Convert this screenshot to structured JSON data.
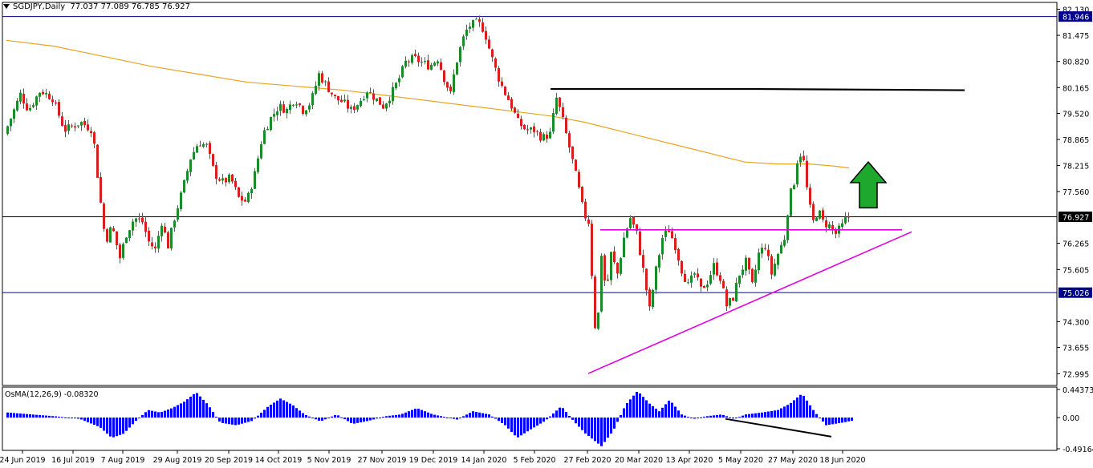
{
  "chart_data": {
    "type": "candlestick",
    "symbol": "SGDJPY,Daily",
    "ohlc_text": "77.037 77.089 76.785 76.927",
    "price_axis": {
      "ylim": [
        72.7,
        82.3
      ],
      "ticks": [
        "82.130",
        "81.475",
        "80.820",
        "80.165",
        "79.520",
        "78.865",
        "78.215",
        "77.560",
        "76.927",
        "76.265",
        "75.605",
        "75.026",
        "74.300",
        "73.655",
        "72.995"
      ],
      "labels_boxed": [
        "81.946",
        "76.927",
        "75.026"
      ]
    },
    "time_axis": {
      "ticks": [
        "24 Jun 2019",
        "16 Jul 2019",
        "7 Aug 2019",
        "29 Aug 2019",
        "20 Sep 2019",
        "14 Oct 2019",
        "5 Nov 2019",
        "27 Nov 2019",
        "19 Dec 2019",
        "14 Jan 2020",
        "5 Feb 2020",
        "27 Feb 2020",
        "20 Mar 2020",
        "13 Apr 2020",
        "5 May 2020",
        "27 May 2020",
        "18 Jun 2020"
      ]
    },
    "price_path": [
      [
        0,
        79.0
      ],
      [
        8,
        79.4
      ],
      [
        20,
        80.0
      ],
      [
        30,
        79.6
      ],
      [
        45,
        80.1
      ],
      [
        60,
        79.9
      ],
      [
        75,
        79.1
      ],
      [
        95,
        79.3
      ],
      [
        110,
        79.1
      ],
      [
        118,
        77.6
      ],
      [
        126,
        76.3
      ],
      [
        134,
        76.7
      ],
      [
        144,
        75.9
      ],
      [
        152,
        76.5
      ],
      [
        162,
        76.9
      ],
      [
        172,
        76.8
      ],
      [
        180,
        76.3
      ],
      [
        188,
        76.1
      ],
      [
        196,
        76.8
      ],
      [
        204,
        76.2
      ],
      [
        212,
        76.9
      ],
      [
        222,
        77.6
      ],
      [
        232,
        78.4
      ],
      [
        242,
        78.8
      ],
      [
        252,
        78.7
      ],
      [
        262,
        78.0
      ],
      [
        272,
        77.8
      ],
      [
        282,
        77.9
      ],
      [
        292,
        77.4
      ],
      [
        302,
        77.3
      ],
      [
        312,
        78.0
      ],
      [
        322,
        79.0
      ],
      [
        332,
        79.4
      ],
      [
        342,
        79.7
      ],
      [
        352,
        79.6
      ],
      [
        362,
        79.9
      ],
      [
        372,
        79.6
      ],
      [
        382,
        79.8
      ],
      [
        392,
        80.5
      ],
      [
        402,
        80.2
      ],
      [
        412,
        79.9
      ],
      [
        422,
        79.8
      ],
      [
        432,
        79.6
      ],
      [
        442,
        79.8
      ],
      [
        452,
        80.1
      ],
      [
        462,
        79.9
      ],
      [
        472,
        79.7
      ],
      [
        482,
        80.0
      ],
      [
        492,
        80.4
      ],
      [
        500,
        80.8
      ],
      [
        510,
        80.9
      ],
      [
        520,
        80.8
      ],
      [
        530,
        80.7
      ],
      [
        540,
        80.9
      ],
      [
        548,
        80.4
      ],
      [
        556,
        80.0
      ],
      [
        562,
        80.7
      ],
      [
        570,
        81.3
      ],
      [
        578,
        81.7
      ],
      [
        590,
        81.8
      ],
      [
        598,
        81.6
      ],
      [
        606,
        81.0
      ],
      [
        614,
        80.5
      ],
      [
        622,
        80.1
      ],
      [
        630,
        79.8
      ],
      [
        640,
        79.3
      ],
      [
        650,
        79.1
      ],
      [
        660,
        79.1
      ],
      [
        670,
        78.9
      ],
      [
        680,
        79.0
      ],
      [
        688,
        79.9
      ],
      [
        694,
        79.5
      ],
      [
        700,
        79.0
      ],
      [
        706,
        78.5
      ],
      [
        714,
        77.8
      ],
      [
        722,
        77.0
      ],
      [
        728,
        76.8
      ],
      [
        732,
        75.5
      ],
      [
        736,
        74.2
      ],
      [
        740,
        74.5
      ],
      [
        744,
        76.0
      ],
      [
        750,
        75.0
      ],
      [
        756,
        76.0
      ],
      [
        764,
        75.5
      ],
      [
        772,
        76.4
      ],
      [
        780,
        76.9
      ],
      [
        788,
        76.5
      ],
      [
        796,
        75.6
      ],
      [
        804,
        74.6
      ],
      [
        812,
        75.6
      ],
      [
        820,
        76.4
      ],
      [
        828,
        76.6
      ],
      [
        836,
        76.2
      ],
      [
        844,
        75.6
      ],
      [
        852,
        75.2
      ],
      [
        860,
        75.5
      ],
      [
        868,
        75.1
      ],
      [
        876,
        75.3
      ],
      [
        884,
        75.7
      ],
      [
        892,
        75.4
      ],
      [
        900,
        74.7
      ],
      [
        908,
        74.9
      ],
      [
        916,
        75.5
      ],
      [
        924,
        75.8
      ],
      [
        932,
        75.2
      ],
      [
        940,
        76.0
      ],
      [
        948,
        76.2
      ],
      [
        956,
        75.5
      ],
      [
        964,
        76.0
      ],
      [
        972,
        76.4
      ],
      [
        978,
        77.4
      ],
      [
        984,
        77.8
      ],
      [
        990,
        78.6
      ],
      [
        996,
        78.3
      ],
      [
        1002,
        77.3
      ],
      [
        1008,
        76.8
      ],
      [
        1014,
        77.1
      ],
      [
        1020,
        76.8
      ],
      [
        1028,
        76.7
      ],
      [
        1036,
        76.5
      ],
      [
        1044,
        76.7
      ],
      [
        1050,
        76.93
      ]
    ],
    "moving_average_path": [
      [
        0,
        81.35
      ],
      [
        60,
        81.2
      ],
      [
        120,
        80.95
      ],
      [
        180,
        80.7
      ],
      [
        240,
        80.5
      ],
      [
        300,
        80.3
      ],
      [
        360,
        80.2
      ],
      [
        420,
        80.1
      ],
      [
        480,
        79.95
      ],
      [
        560,
        79.75
      ],
      [
        620,
        79.6
      ],
      [
        680,
        79.45
      ],
      [
        720,
        79.3
      ],
      [
        760,
        79.1
      ],
      [
        800,
        78.9
      ],
      [
        840,
        78.7
      ],
      [
        880,
        78.5
      ],
      [
        920,
        78.3
      ],
      [
        960,
        78.25
      ],
      [
        1000,
        78.25
      ],
      [
        1030,
        78.2
      ],
      [
        1050,
        78.15
      ]
    ],
    "horizontal_lines": [
      {
        "price": 81.946,
        "color": "#00008b"
      },
      {
        "price": 76.927,
        "color": "#000000"
      },
      {
        "price": 75.026,
        "color": "#00008b"
      }
    ],
    "resistance_line": {
      "x": [
        686,
        944,
        1202
      ],
      "price": [
        80.13,
        80.13,
        80.1
      ],
      "color": "#000000"
    },
    "support_line_magenta": {
      "x": [
        748,
        1124
      ],
      "price": [
        76.6,
        76.6
      ],
      "color": "#e000e0"
    },
    "trendline_magenta": {
      "x": [
        733,
        1136
      ],
      "price": [
        73.0,
        76.55
      ],
      "color": "#e000e0"
    },
    "arrow": {
      "x_center": 1082,
      "price_top": 78.3,
      "price_bottom": 77.15,
      "color": "#1ea82e",
      "direction": "up"
    },
    "osma": {
      "label": "OsMA(12,26,9) -0.08320",
      "ticks": [
        "0.44373",
        "0.00",
        "-0.49164"
      ],
      "ylim": [
        -0.49164,
        0.44373
      ],
      "points": [
        [
          0,
          0.08
        ],
        [
          60,
          0.02
        ],
        [
          90,
          -0.02
        ],
        [
          115,
          -0.15
        ],
        [
          130,
          -0.32
        ],
        [
          145,
          -0.25
        ],
        [
          160,
          -0.05
        ],
        [
          175,
          0.12
        ],
        [
          190,
          0.08
        ],
        [
          205,
          0.15
        ],
        [
          220,
          0.25
        ],
        [
          235,
          0.4
        ],
        [
          250,
          0.2
        ],
        [
          265,
          -0.08
        ],
        [
          285,
          -0.12
        ],
        [
          305,
          -0.05
        ],
        [
          325,
          0.18
        ],
        [
          340,
          0.3
        ],
        [
          355,
          0.2
        ],
        [
          370,
          0.05
        ],
        [
          390,
          -0.06
        ],
        [
          410,
          0.05
        ],
        [
          430,
          -0.1
        ],
        [
          450,
          -0.05
        ],
        [
          470,
          0.02
        ],
        [
          490,
          0.05
        ],
        [
          510,
          0.15
        ],
        [
          530,
          0.05
        ],
        [
          560,
          -0.03
        ],
        [
          580,
          0.1
        ],
        [
          600,
          0.05
        ],
        [
          620,
          -0.12
        ],
        [
          635,
          -0.32
        ],
        [
          650,
          -0.2
        ],
        [
          670,
          -0.05
        ],
        [
          690,
          0.18
        ],
        [
          705,
          -0.05
        ],
        [
          720,
          -0.25
        ],
        [
          740,
          -0.45
        ],
        [
          755,
          -0.2
        ],
        [
          770,
          0.2
        ],
        [
          785,
          0.42
        ],
        [
          800,
          0.22
        ],
        [
          812,
          0.1
        ],
        [
          825,
          0.28
        ],
        [
          840,
          0.05
        ],
        [
          855,
          -0.02
        ],
        [
          870,
          0.02
        ],
        [
          890,
          0.05
        ],
        [
          905,
          -0.02
        ],
        [
          920,
          0.05
        ],
        [
          940,
          0.08
        ],
        [
          960,
          0.12
        ],
        [
          975,
          0.22
        ],
        [
          990,
          0.38
        ],
        [
          1005,
          0.1
        ],
        [
          1020,
          -0.12
        ],
        [
          1040,
          -0.08
        ],
        [
          1052,
          -0.05
        ]
      ],
      "color": "#0000ff",
      "divergence_line": {
        "x": [
          904,
          1036
        ],
        "value": [
          -0.02,
          -0.3
        ]
      }
    }
  }
}
